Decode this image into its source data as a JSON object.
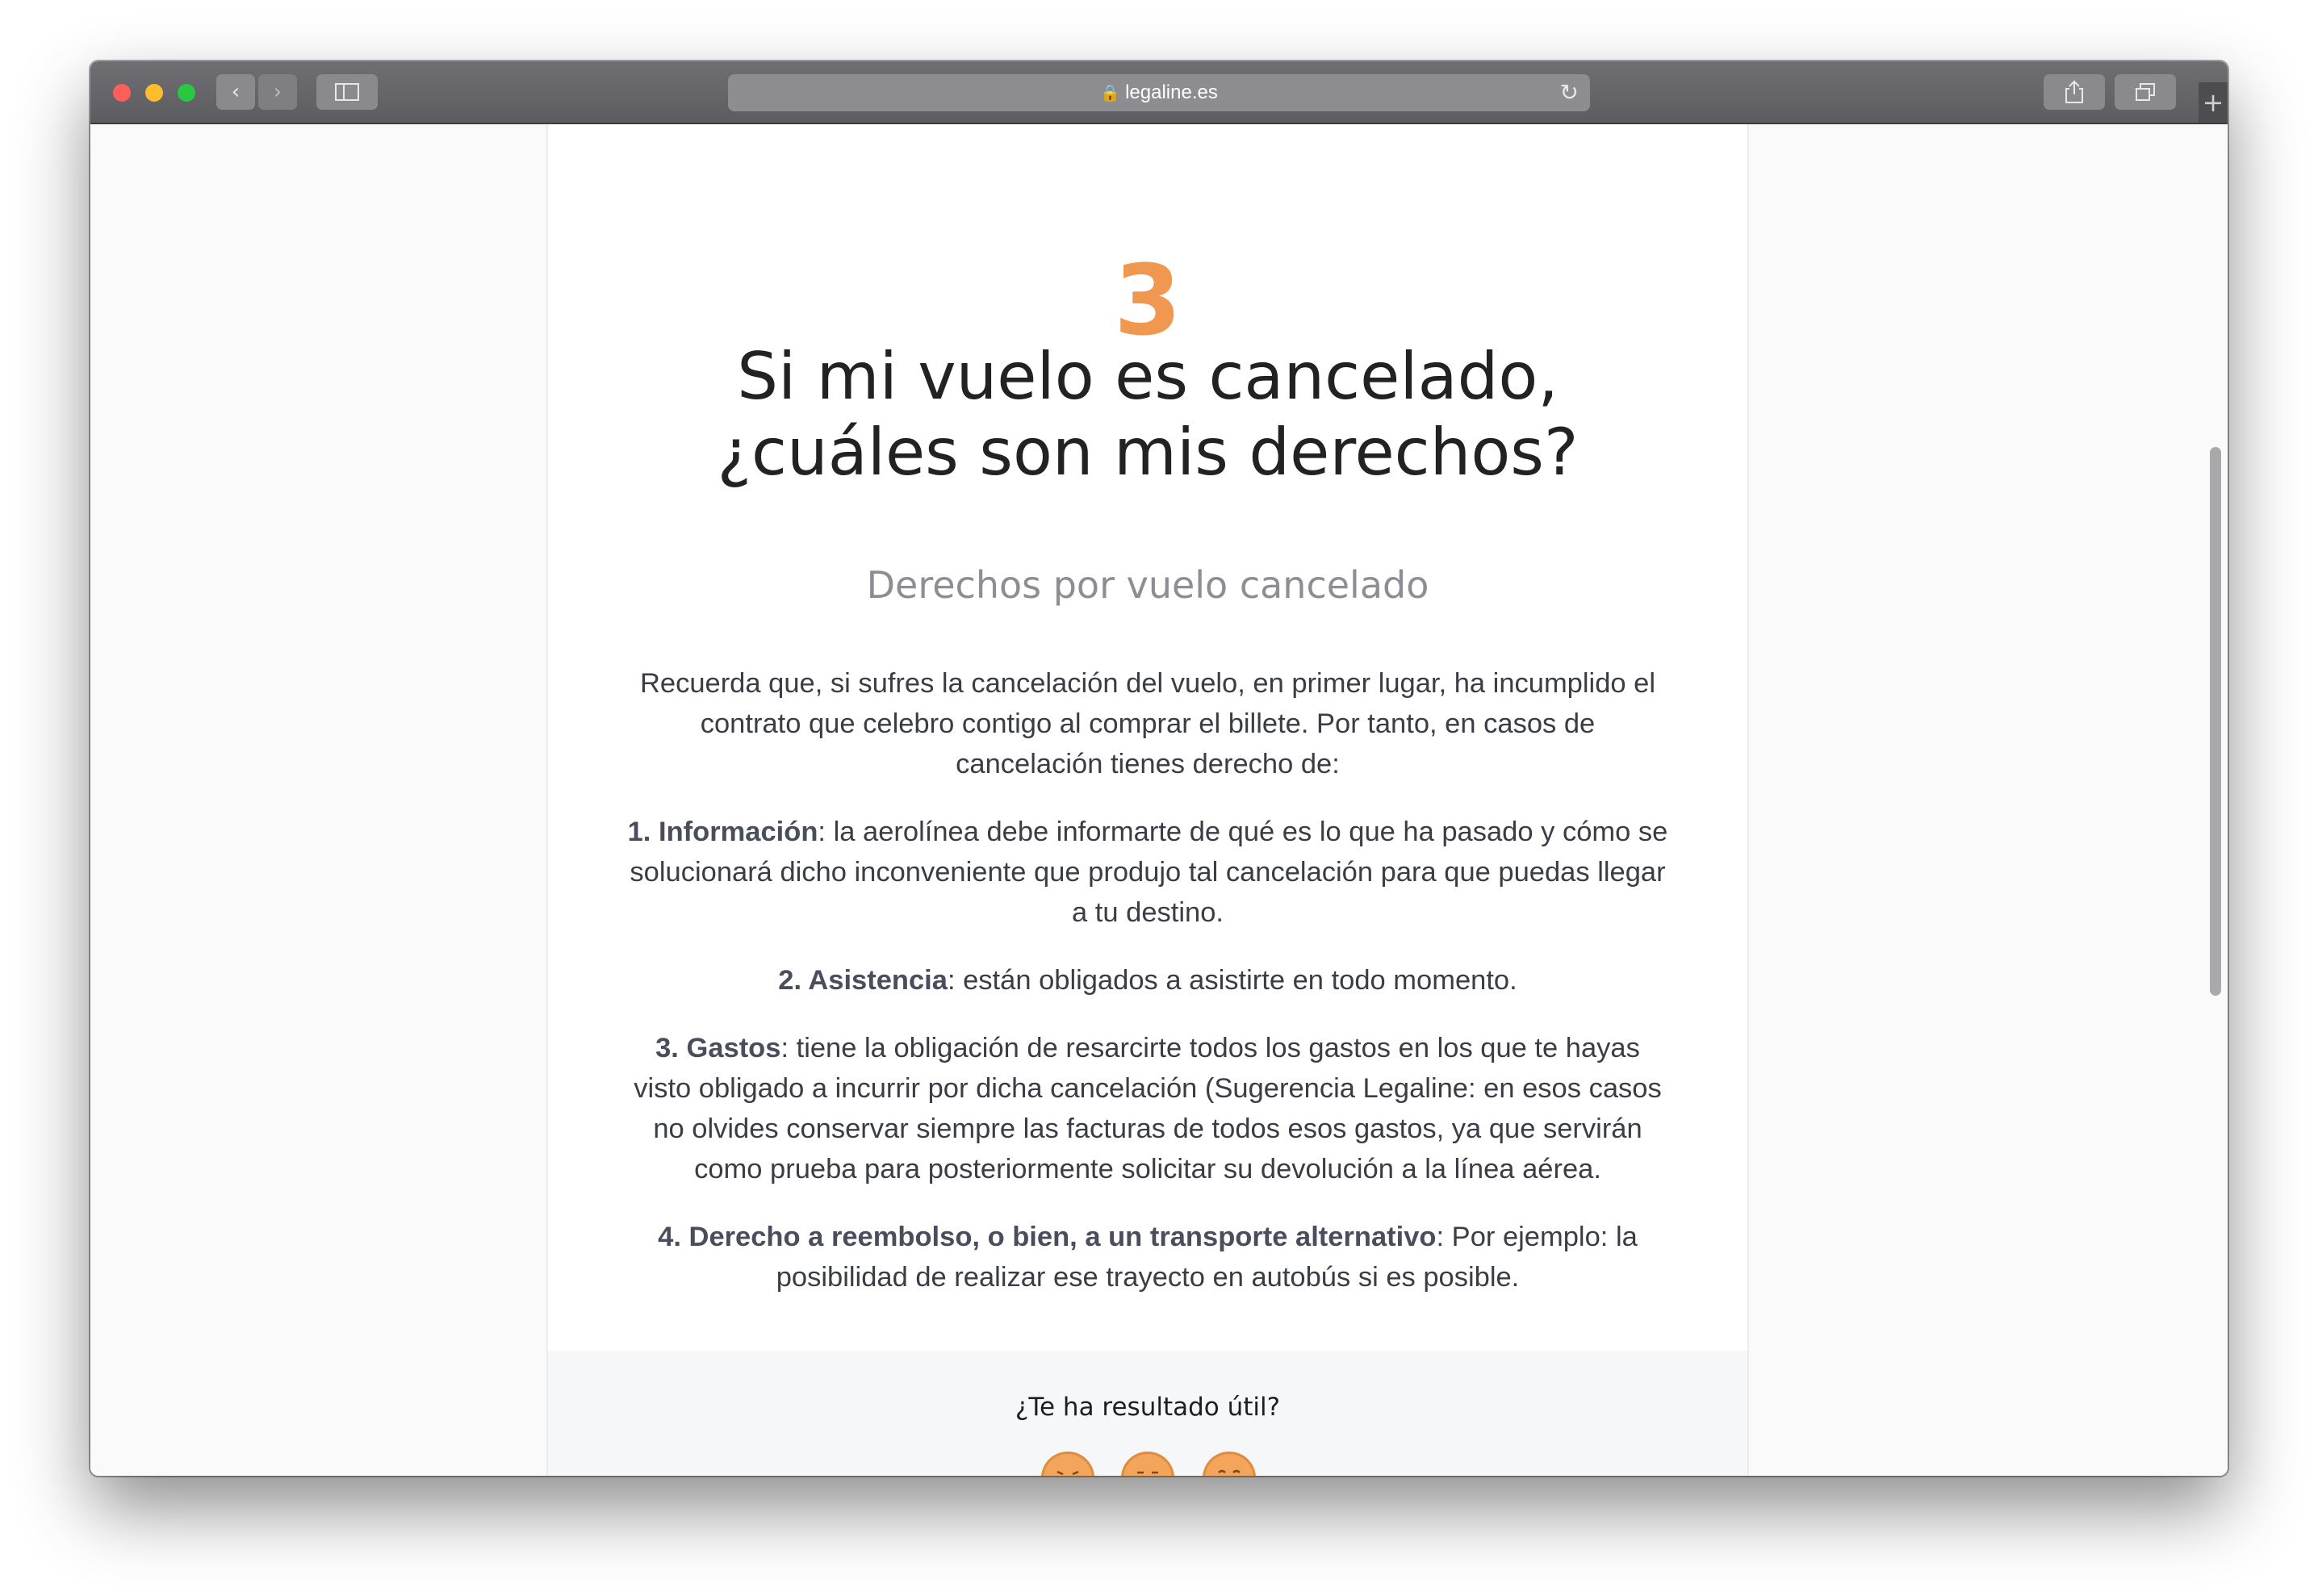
{
  "browser": {
    "url": "legaline.es",
    "lock_icon": "lock-icon",
    "buttons": [
      "back",
      "forward",
      "sidebar",
      "share",
      "tabs",
      "new-tab"
    ]
  },
  "article": {
    "step_number": "3",
    "title": "Si mi vuelo es cancelado, ¿cuáles son mis derechos?",
    "subtitle": "Derechos por vuelo cancelado",
    "intro": "Recuerda que, si sufres la cancelación del vuelo, en primer lugar, ha incumplido el contrato que celebro contigo al comprar el billete. Por tanto, en casos de cancelación tienes derecho de:",
    "items": [
      {
        "label": "1. Información",
        "text": ": la aerolínea debe informarte de qué es lo que ha pasado y cómo se solucionará dicho inconveniente que produjo tal cancelación para que puedas llegar a tu destino."
      },
      {
        "label": "2. Asistencia",
        "text": ": están obligados a asistirte en todo momento."
      },
      {
        "label": "3. Gastos",
        "text": ": tiene la obligación de resarcirte todos los gastos en los que te hayas visto obligado a incurrir por dicha cancelación (Sugerencia Legaline: en esos casos no olvides conservar siempre las facturas de todos esos gastos, ya que servirán como prueba para posteriormente solicitar su devolución a la línea aérea."
      },
      {
        "label": "4. Derecho a reembolso, o bien, a un transporte alternativo",
        "text": ": Por ejemplo: la posibilidad de realizar ese trayecto en autobús si es posible."
      }
    ]
  },
  "feedback": {
    "question": "¿Te ha resultado útil?",
    "emojis": [
      "sad-face-icon",
      "neutral-face-icon",
      "happy-face-icon"
    ]
  },
  "colors": {
    "accent": "#f09850",
    "emoji": "#f2a55b"
  }
}
